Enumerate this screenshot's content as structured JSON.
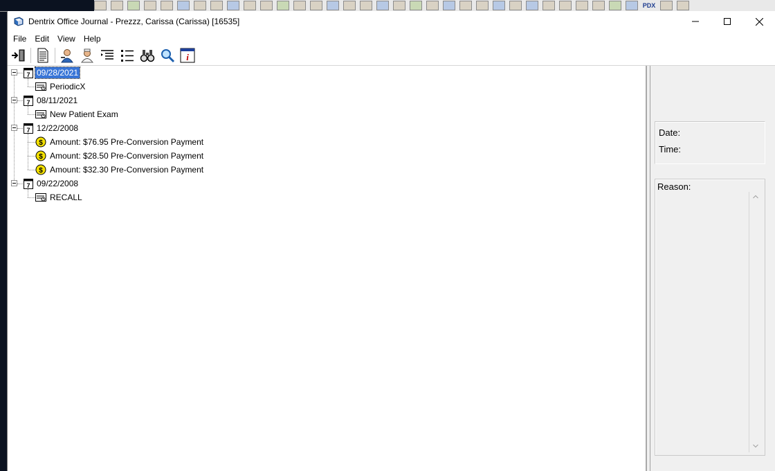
{
  "window": {
    "title": "Dentrix Office Journal - Prezzz, Carissa (Carissa) [16535]"
  },
  "menu": {
    "file": "File",
    "edit": "Edit",
    "view": "View",
    "help": "Help"
  },
  "background_app": {
    "partial_label": "PDX"
  },
  "toolbar": {
    "icons": [
      "exit-icon",
      "document-icon",
      "patient-icon",
      "provider-icon",
      "indent-list-icon",
      "bullet-list-icon",
      "binoculars-icon",
      "magnifier-icon",
      "info-icon"
    ]
  },
  "tree": {
    "groups": [
      {
        "date": "09/28/2021",
        "selected": true,
        "children": [
          {
            "label": "PeriodicX",
            "icon": "appointment-card-icon"
          }
        ]
      },
      {
        "date": "08/11/2021",
        "selected": false,
        "children": [
          {
            "label": "New Patient Exam",
            "icon": "appointment-card-icon"
          }
        ]
      },
      {
        "date": "12/22/2008",
        "selected": false,
        "children": [
          {
            "label": "Amount: $76.95 Pre-Conversion Payment",
            "icon": "dollar-coin-icon"
          },
          {
            "label": "Amount: $28.50 Pre-Conversion Payment",
            "icon": "dollar-coin-icon"
          },
          {
            "label": "Amount: $32.30 Pre-Conversion Payment",
            "icon": "dollar-coin-icon"
          }
        ]
      },
      {
        "date": "09/22/2008",
        "selected": false,
        "children": [
          {
            "label": "RECALL",
            "icon": "appointment-card-icon"
          }
        ]
      }
    ]
  },
  "details": {
    "date_label": "Date:",
    "time_label": "Time:",
    "reason_label": "Reason:"
  },
  "colors": {
    "selection": "#3875d7",
    "coin": "#f3e000",
    "pane_bg": "#f0f0f0"
  }
}
